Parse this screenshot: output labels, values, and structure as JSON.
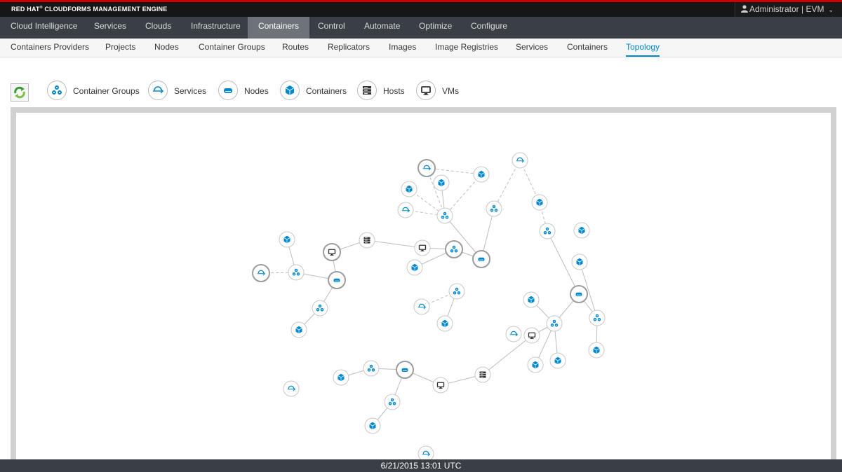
{
  "brand": {
    "name": "RED HAT",
    "mark": "®",
    "product": " CLOUDFORMS MANAGEMENT ENGINE"
  },
  "user": {
    "label": "Administrator | EVM",
    "icon": "user-icon",
    "caret_icon": "chevron-down-icon"
  },
  "primary_nav": {
    "items": [
      "Cloud Intelligence",
      "Services",
      "Clouds",
      "Infrastructure",
      "Containers",
      "Control",
      "Automate",
      "Optimize",
      "Configure"
    ],
    "active": "Containers"
  },
  "secondary_nav": {
    "items": [
      "Containers Providers",
      "Projects",
      "Nodes",
      "Container Groups",
      "Routes",
      "Replicators",
      "Images",
      "Image Registries",
      "Services",
      "Containers",
      "Topology"
    ],
    "active": "Topology"
  },
  "legend": {
    "refresh_icon": "refresh-icon",
    "items": [
      {
        "label": "Container Groups",
        "icon": "container-group-icon"
      },
      {
        "label": "Services",
        "icon": "service-icon"
      },
      {
        "label": "Nodes",
        "icon": "node-icon"
      },
      {
        "label": "Containers",
        "icon": "container-icon"
      },
      {
        "label": "Hosts",
        "icon": "host-icon"
      },
      {
        "label": "VMs",
        "icon": "vm-icon"
      }
    ]
  },
  "colors": {
    "accent": "#0088ce",
    "brand_red": "#cc0000",
    "nav_bg": "#393f45"
  },
  "footer": {
    "timestamp": "6/21/2015 13:01 UTC"
  }
}
